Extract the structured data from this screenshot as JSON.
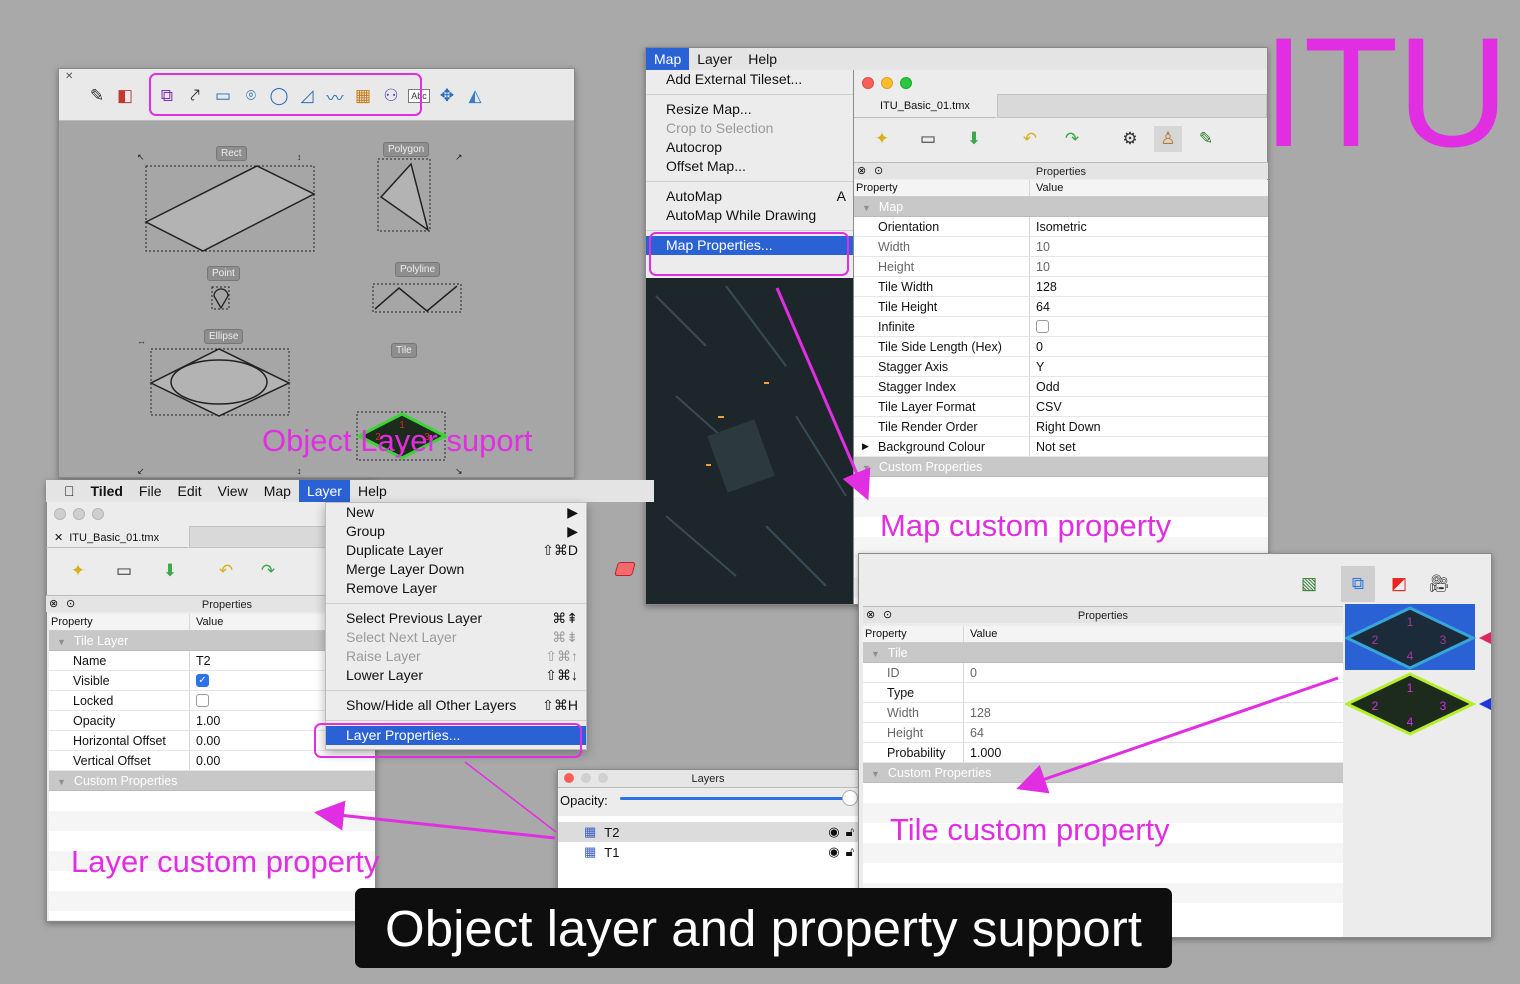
{
  "banner": {
    "itu": "ITU",
    "caption": "Object layer and property support"
  },
  "annotations": {
    "object_layer": "Object Layer suport",
    "map_custom": "Map custom property",
    "layer_custom": "Layer custom property",
    "tile_custom": "Tile custom property"
  },
  "object_window": {
    "shapes": {
      "rect": "Rect",
      "polygon": "Polygon",
      "point": "Point",
      "polyline": "Polyline",
      "ellipse": "Ellipse",
      "tile": "Tile"
    },
    "tool_text": "Abc",
    "tile_numbers": [
      "1",
      "2",
      "3",
      "4"
    ]
  },
  "map_window": {
    "menubar": [
      "Map",
      "Layer",
      "Help"
    ],
    "menu": [
      {
        "label": "Add External Tileset...",
        "state": "normal"
      },
      {
        "sep": true
      },
      {
        "label": "Resize Map...",
        "state": "normal"
      },
      {
        "label": "Crop to Selection",
        "state": "disabled"
      },
      {
        "label": "Autocrop",
        "state": "normal"
      },
      {
        "label": "Offset Map...",
        "state": "normal"
      },
      {
        "sep": true
      },
      {
        "label": "AutoMap",
        "shortcut": "A",
        "state": "normal"
      },
      {
        "label": "AutoMap While Drawing",
        "state": "normal"
      },
      {
        "sep": true
      },
      {
        "label": "Map Properties...",
        "state": "selected"
      }
    ],
    "filename": "ITU_Basic_01.tmx",
    "panel_title": "Properties",
    "col_property": "Property",
    "col_value": "Value",
    "group": "Map",
    "rows": [
      {
        "k": "Orientation",
        "v": "Isometric"
      },
      {
        "k": "Width",
        "v": "10",
        "dis": true
      },
      {
        "k": "Height",
        "v": "10",
        "dis": true
      },
      {
        "k": "Tile Width",
        "v": "128"
      },
      {
        "k": "Tile Height",
        "v": "64"
      },
      {
        "k": "Infinite",
        "v": "",
        "check": false
      },
      {
        "k": "Tile Side Length (Hex)",
        "v": "0"
      },
      {
        "k": "Stagger Axis",
        "v": "Y"
      },
      {
        "k": "Stagger Index",
        "v": "Odd"
      },
      {
        "k": "Tile Layer Format",
        "v": "CSV"
      },
      {
        "k": "Tile Render Order",
        "v": "Right Down"
      },
      {
        "k": "Background Colour",
        "v": "Not set",
        "expand": true
      }
    ],
    "custom": "Custom Properties"
  },
  "layer_window": {
    "menubar": [
      "Tiled",
      "File",
      "Edit",
      "View",
      "Map",
      "Layer",
      "Help"
    ],
    "filename": "ITU_Basic_01.tmx",
    "panel_title": "Properties",
    "col_property": "Property",
    "col_value": "Value",
    "group": "Tile Layer",
    "rows": [
      {
        "k": "Name",
        "v": "T2"
      },
      {
        "k": "Visible",
        "v": "",
        "check": true
      },
      {
        "k": "Locked",
        "v": "",
        "check": false
      },
      {
        "k": "Opacity",
        "v": "1.00"
      },
      {
        "k": "Horizontal Offset",
        "v": "0.00"
      },
      {
        "k": "Vertical Offset",
        "v": "0.00"
      }
    ],
    "custom": "Custom Properties",
    "menu": [
      {
        "label": "New",
        "shortcut": "▶",
        "state": "normal"
      },
      {
        "label": "Group",
        "shortcut": "▶",
        "state": "normal"
      },
      {
        "label": "Duplicate Layer",
        "shortcut": "⇧⌘D",
        "state": "normal"
      },
      {
        "label": "Merge Layer Down",
        "state": "normal"
      },
      {
        "label": "Remove Layer",
        "state": "normal"
      },
      {
        "sep": true
      },
      {
        "label": "Select Previous Layer",
        "shortcut": "⌘⇞",
        "state": "normal"
      },
      {
        "label": "Select Next Layer",
        "shortcut": "⌘⇟",
        "state": "disabled"
      },
      {
        "label": "Raise Layer",
        "shortcut": "⇧⌘↑",
        "state": "disabled"
      },
      {
        "label": "Lower Layer",
        "shortcut": "⇧⌘↓",
        "state": "normal"
      },
      {
        "sep": true
      },
      {
        "label": "Show/Hide all Other Layers",
        "shortcut": "⇧⌘H",
        "state": "normal"
      },
      {
        "sep": true
      },
      {
        "label": "Layer Properties...",
        "state": "selected"
      }
    ]
  },
  "layers_panel": {
    "title": "Layers",
    "opacity_label": "Opacity:",
    "opacity": 1.0,
    "layers": [
      {
        "name": "T2",
        "selected": true
      },
      {
        "name": "T1",
        "selected": false
      }
    ]
  },
  "tile_window": {
    "panel_title": "Properties",
    "col_property": "Property",
    "col_value": "Value",
    "group": "Tile",
    "rows": [
      {
        "k": "ID",
        "v": "0",
        "dis": true
      },
      {
        "k": "Type",
        "v": ""
      },
      {
        "k": "Width",
        "v": "128",
        "dis": true
      },
      {
        "k": "Height",
        "v": "64",
        "dis": true
      },
      {
        "k": "Probability",
        "v": "1.000"
      }
    ],
    "custom": "Custom Properties",
    "tile_numbers": [
      "1",
      "2",
      "3",
      "4"
    ]
  },
  "colors": {
    "accent": "#e22ee2",
    "selection": "#2a62d6"
  }
}
